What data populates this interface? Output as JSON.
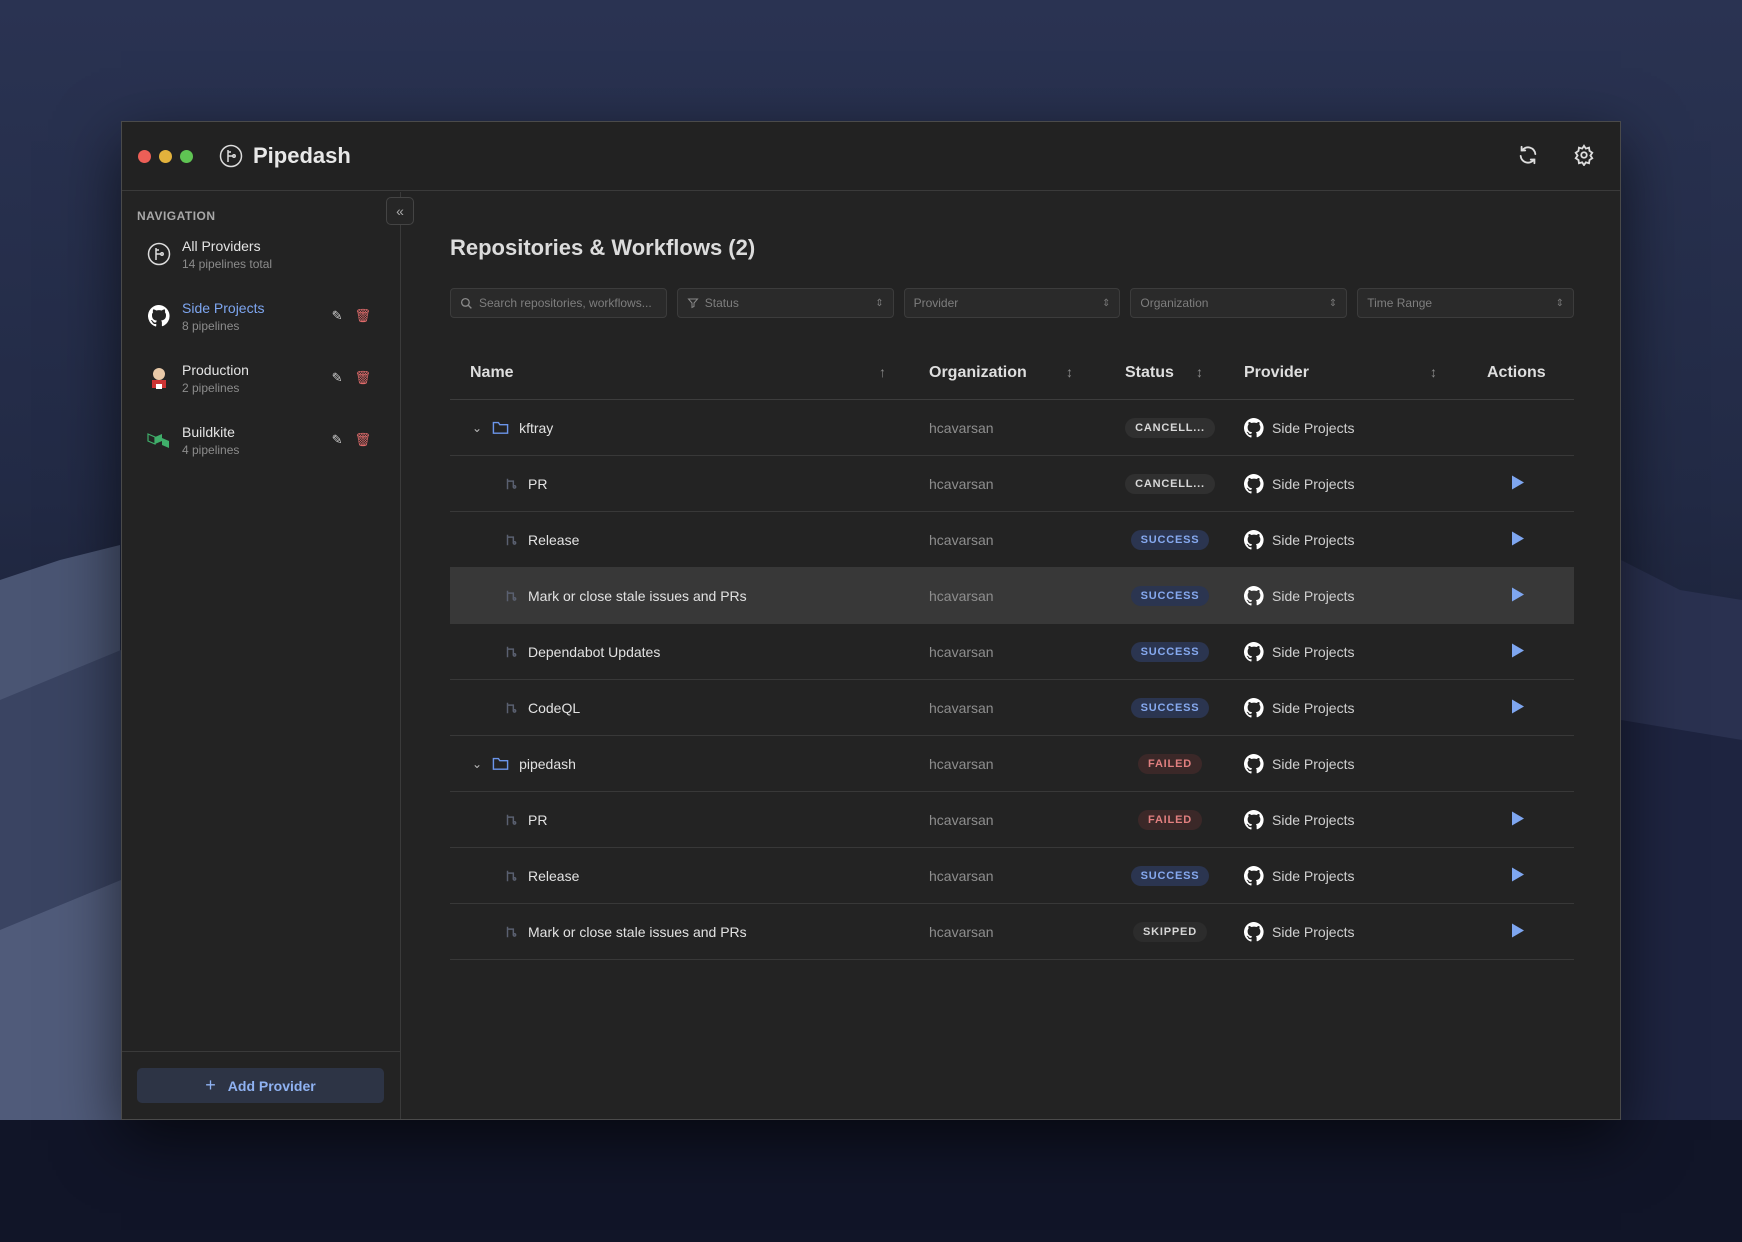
{
  "app": {
    "title": "Pipedash"
  },
  "sidebar": {
    "nav_label": "NAVIGATION",
    "items": [
      {
        "label": "All Providers",
        "sub": "14 pipelines total",
        "icon": "pipedash-icon",
        "active": false
      },
      {
        "label": "Side Projects",
        "sub": "8 pipelines",
        "icon": "github-icon",
        "active": true
      },
      {
        "label": "Production",
        "sub": "2 pipelines",
        "icon": "jenkins-icon",
        "active": false
      },
      {
        "label": "Buildkite",
        "sub": "4 pipelines",
        "icon": "buildkite-icon",
        "active": false
      }
    ],
    "add_provider": "Add Provider"
  },
  "main": {
    "title": "Repositories & Workflows (2)",
    "filters": {
      "search_placeholder": "Search repositories, workflows...",
      "status": "Status",
      "provider": "Provider",
      "organization": "Organization",
      "time_range": "Time Range"
    },
    "columns": {
      "name": "Name",
      "organization": "Organization",
      "status": "Status",
      "provider": "Provider",
      "actions": "Actions"
    },
    "rows": [
      {
        "type": "repo",
        "name": "kftray",
        "org": "hcavarsan",
        "status": "CANCELL...",
        "provider": "Side Projects"
      },
      {
        "type": "workflow",
        "name": "PR",
        "org": "hcavarsan",
        "status": "CANCELL...",
        "provider": "Side Projects"
      },
      {
        "type": "workflow",
        "name": "Release",
        "org": "hcavarsan",
        "status": "SUCCESS",
        "provider": "Side Projects"
      },
      {
        "type": "workflow",
        "name": "Mark or close stale issues and PRs",
        "org": "hcavarsan",
        "status": "SUCCESS",
        "provider": "Side Projects",
        "highlighted": true
      },
      {
        "type": "workflow",
        "name": "Dependabot Updates",
        "org": "hcavarsan",
        "status": "SUCCESS",
        "provider": "Side Projects"
      },
      {
        "type": "workflow",
        "name": "CodeQL",
        "org": "hcavarsan",
        "status": "SUCCESS",
        "provider": "Side Projects"
      },
      {
        "type": "repo",
        "name": "pipedash",
        "org": "hcavarsan",
        "status": "FAILED",
        "provider": "Side Projects"
      },
      {
        "type": "workflow",
        "name": "PR",
        "org": "hcavarsan",
        "status": "FAILED",
        "provider": "Side Projects"
      },
      {
        "type": "workflow",
        "name": "Release",
        "org": "hcavarsan",
        "status": "SUCCESS",
        "provider": "Side Projects"
      },
      {
        "type": "workflow",
        "name": "Mark or close stale issues and PRs",
        "org": "hcavarsan",
        "status": "SKIPPED",
        "provider": "Side Projects"
      }
    ]
  },
  "colors": {
    "accent": "#7ea6f0",
    "success": "#86a9ef",
    "failed": "#e07f7f",
    "delete": "#e06b6b"
  }
}
